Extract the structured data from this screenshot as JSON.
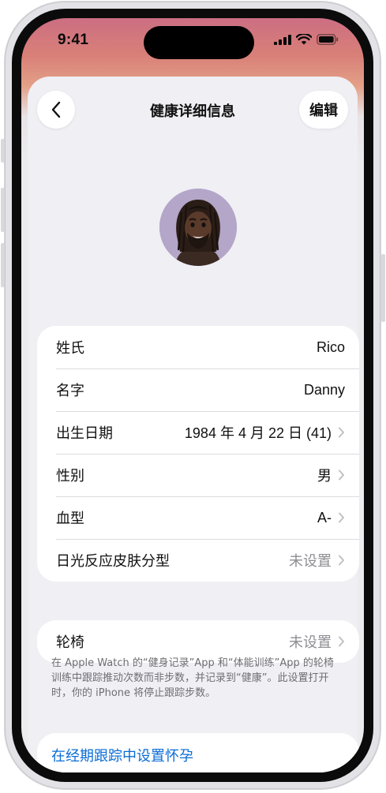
{
  "status_bar": {
    "time": "9:41"
  },
  "nav": {
    "title": "健康详细信息",
    "edit_label": "编辑",
    "back_icon": "chevron-left-icon"
  },
  "details": [
    {
      "label": "姓氏",
      "value": "Rico",
      "chevron": false,
      "muted": false
    },
    {
      "label": "名字",
      "value": "Danny",
      "chevron": false,
      "muted": false
    },
    {
      "label": "出生日期",
      "value": "1984 年 4 月 22 日 (41)",
      "chevron": true,
      "muted": false
    },
    {
      "label": "性别",
      "value": "男",
      "chevron": true,
      "muted": false
    },
    {
      "label": "血型",
      "value": "A-",
      "chevron": true,
      "muted": false
    },
    {
      "label": "日光反应皮肤分型",
      "value": "未设置",
      "chevron": true,
      "muted": true
    }
  ],
  "wheelchair": {
    "label": "轮椅",
    "value": "未设置"
  },
  "footnote": "在 Apple Watch 的“健身记录”App 和“体能训练”App 的轮椅训练中跟踪推动次数而非步数，并记录到“健康”。此设置打开时，你的 iPhone 将停止跟踪步数。",
  "pregnancy_link": "在经期跟踪中设置怀孕",
  "colors": {
    "link": "#0a6cd6",
    "muted": "#8e8e93",
    "sheet": "#efeff4"
  }
}
